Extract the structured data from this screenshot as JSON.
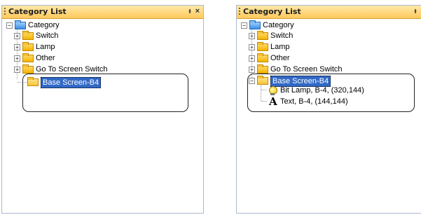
{
  "panel_title": "Category List",
  "controls": {
    "pin_icon": "pin-icon",
    "pin_glyph": "&#x2020;",
    "close_glyph": "×"
  },
  "tree": {
    "expander_plus": "+",
    "expander_minus": "−",
    "root": "Category",
    "folders": [
      "Switch",
      "Lamp",
      "Other",
      "Go To Screen Switch"
    ],
    "screen": "Base Screen-B4",
    "children": [
      "Bit Lamp, B-4, (320,144)",
      "Text, B-4, (144,144)"
    ],
    "text_glyph": "A"
  },
  "colors": {
    "selection": "#3169c6",
    "titlebar": "#ffc95c"
  }
}
